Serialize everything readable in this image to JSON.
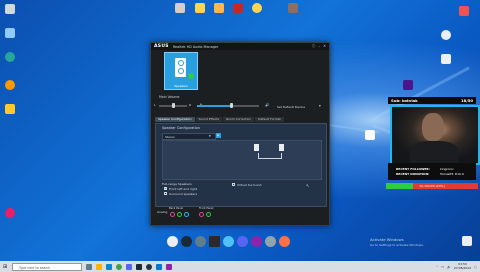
{
  "window": {
    "brand": "ASUS",
    "title": "Realtek HD Audio Manager",
    "device_tile_label": "Speakers",
    "main_volume_label": "Main Volume",
    "default_device_label": "Set Default Device",
    "tabs": [
      "Speaker Configuration",
      "Sound Effects",
      "Room Correction",
      "Default Format"
    ],
    "active_tab": "Speaker Configuration",
    "section_title": "Speaker Configuration",
    "config_value": "Stereo",
    "fullrange_title": "Full-range Speakers",
    "options": [
      {
        "label": "Front left and right",
        "checked": true
      },
      {
        "label": "Surround speakers",
        "checked": false
      }
    ],
    "virtual_surround_label": "Virtual Surround",
    "virtual_surround_checked": false,
    "analog_label": "Analog",
    "back_panel_label": "Back Panel",
    "front_panel_label": "Front Panel",
    "volume_level": 0.55,
    "balance_level": 0.5
  },
  "overlay": {
    "sub_label": "Sub: kotviak",
    "sub_count": "18/50",
    "latest_follower_label": "RECENT FOLLOWER:",
    "latest_follower": "kingronic",
    "latest_donation_label": "RECENT DONATION:",
    "latest_donation": "TomasP3: €10.9",
    "goal_text": "29.19/100 (29%)",
    "goal_progress": 0.29
  },
  "desktop": {
    "activate_title": "Activate Windows",
    "activate_sub": "Go to Settings to activate Windows."
  },
  "taskbar": {
    "search_placeholder": "Type here to search",
    "time": "03:50",
    "date": "07/08/2022"
  },
  "colors": {
    "accent": "#2a9fe0",
    "overlay_border": "#21b8e8",
    "goal_fill": "#2ecc40",
    "goal_rest": "#e53935"
  }
}
